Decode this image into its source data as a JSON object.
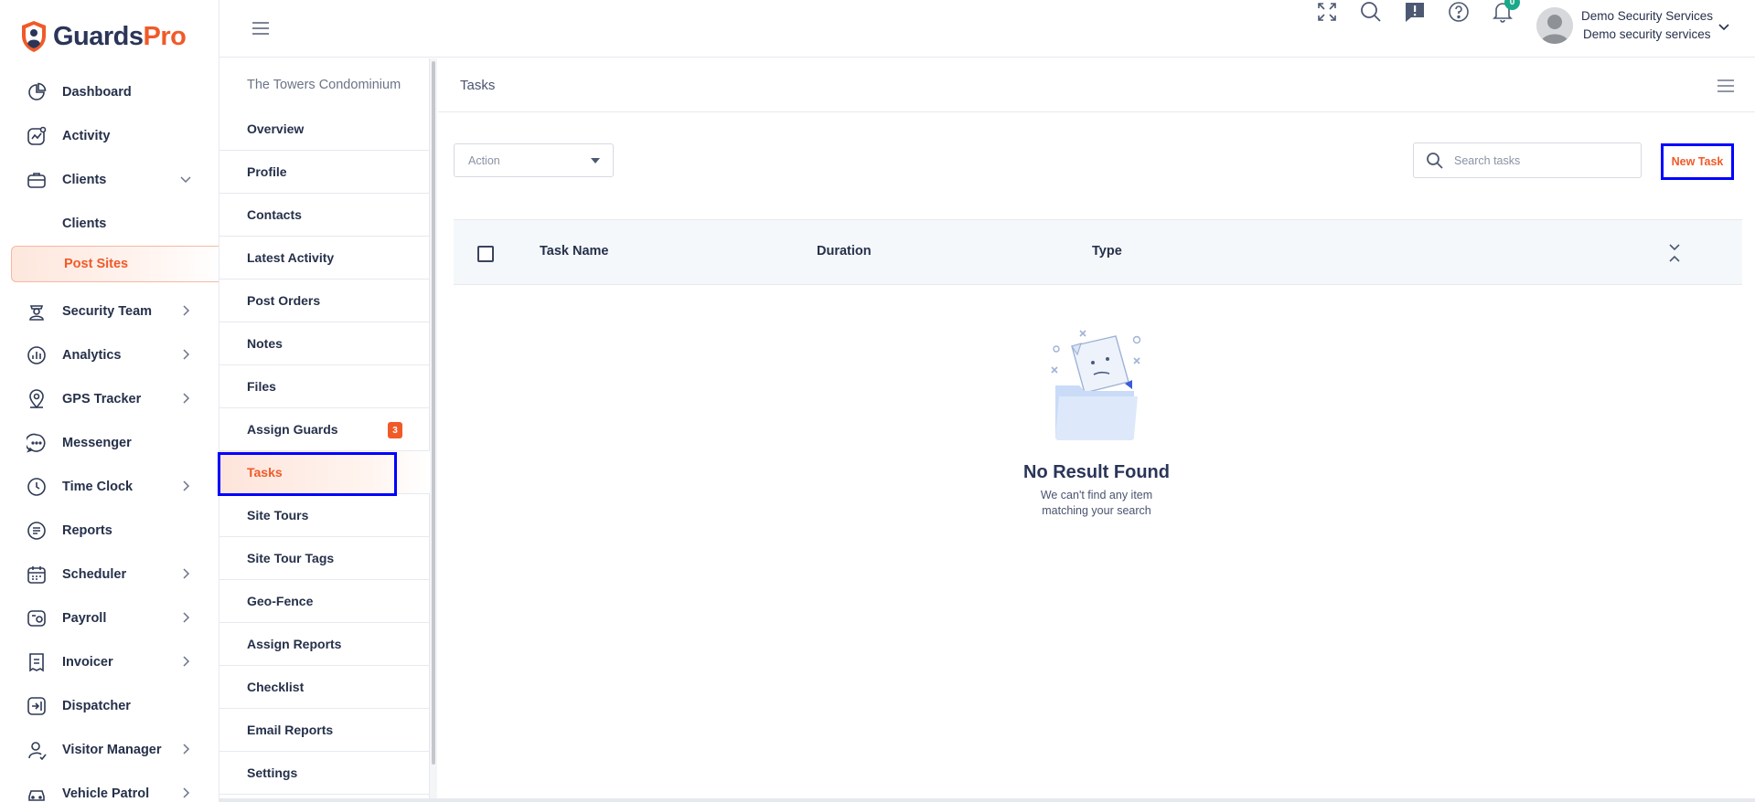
{
  "brand": {
    "name_part1": "Guards",
    "name_part2": "Pro",
    "accent": "#f05a28",
    "primary": "#2a3558"
  },
  "sidebar": {
    "items": [
      {
        "label": "Dashboard",
        "icon": "dashboard-icon"
      },
      {
        "label": "Activity",
        "icon": "activity-icon"
      },
      {
        "label": "Clients",
        "icon": "briefcase-icon",
        "expanded": true
      },
      {
        "label": "Clients",
        "sub": true
      },
      {
        "label": "Post Sites",
        "sub": true,
        "active": true
      },
      {
        "label": "Security Team",
        "icon": "guard-icon",
        "chevron": true
      },
      {
        "label": "Analytics",
        "icon": "analytics-icon",
        "chevron": true
      },
      {
        "label": "GPS Tracker",
        "icon": "location-pin-icon",
        "chevron": true
      },
      {
        "label": "Messenger",
        "icon": "chat-bubble-icon"
      },
      {
        "label": "Time Clock",
        "icon": "clock-icon",
        "chevron": true
      },
      {
        "label": "Reports",
        "icon": "report-icon"
      },
      {
        "label": "Scheduler",
        "icon": "calendar-icon",
        "chevron": true
      },
      {
        "label": "Payroll",
        "icon": "wallet-icon",
        "chevron": true
      },
      {
        "label": "Invoicer",
        "icon": "invoice-icon",
        "chevron": true
      },
      {
        "label": "Dispatcher",
        "icon": "dispatch-icon"
      },
      {
        "label": "Visitor Manager",
        "icon": "visitor-icon",
        "chevron": true
      },
      {
        "label": "Vehicle Patrol",
        "icon": "vehicle-icon",
        "chevron": true
      }
    ]
  },
  "header": {
    "icons": [
      "expand-icon",
      "search-icon",
      "feedback-icon",
      "help-icon",
      "bell-icon"
    ],
    "notification_count": "0",
    "user_name": "Demo Security Services",
    "user_org": "Demo security services"
  },
  "subnav": {
    "title": "The Towers Condominium",
    "items": [
      {
        "label": "Overview"
      },
      {
        "label": "Profile"
      },
      {
        "label": "Contacts"
      },
      {
        "label": "Latest Activity"
      },
      {
        "label": "Post Orders"
      },
      {
        "label": "Notes"
      },
      {
        "label": "Files"
      },
      {
        "label": "Assign Guards",
        "badge": "3"
      },
      {
        "label": "Tasks",
        "active": true
      },
      {
        "label": "Site Tours"
      },
      {
        "label": "Site Tour Tags"
      },
      {
        "label": "Geo-Fence"
      },
      {
        "label": "Assign Reports"
      },
      {
        "label": "Checklist"
      },
      {
        "label": "Email Reports"
      },
      {
        "label": "Settings"
      }
    ]
  },
  "main": {
    "title": "Tasks",
    "action_label": "Action",
    "search_placeholder": "Search tasks",
    "new_task_label": "New Task",
    "columns": [
      "Task Name",
      "Duration",
      "Type"
    ],
    "empty_title": "No Result Found",
    "empty_subtitle": "We can't find any item matching your search"
  }
}
